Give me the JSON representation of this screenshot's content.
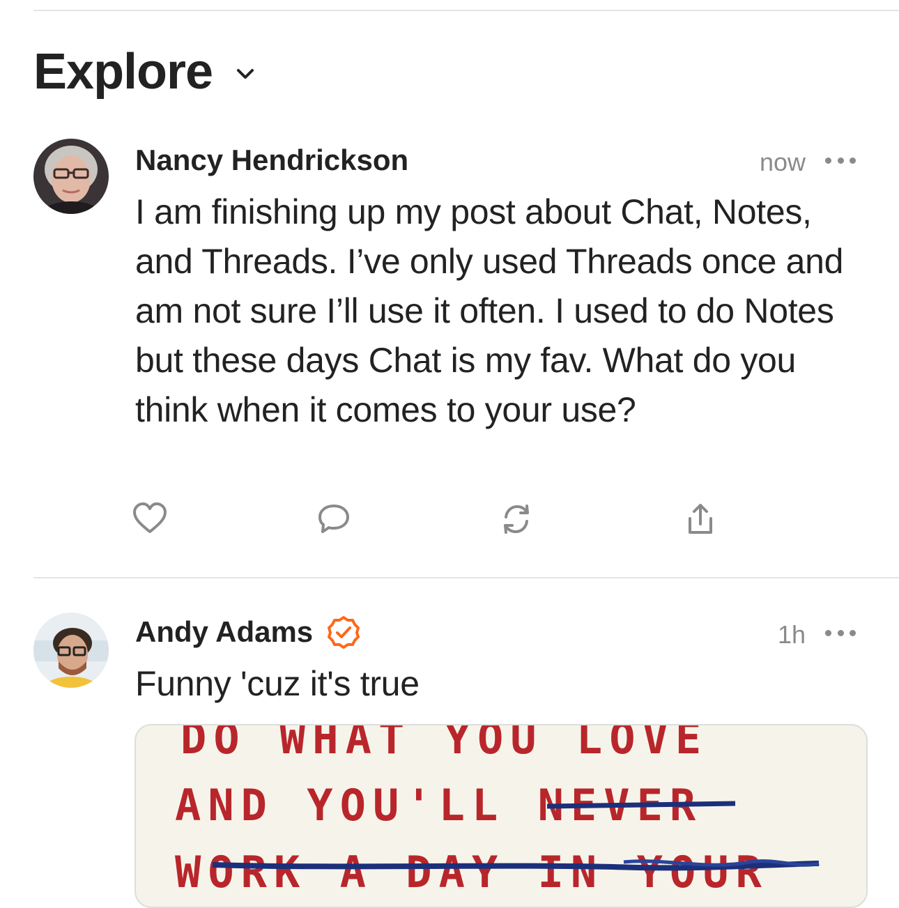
{
  "feed": {
    "title": "Explore"
  },
  "posts": [
    {
      "author": "Nancy Hendrickson",
      "time": "now",
      "text": "I am finishing up my post about Chat, Notes, and Threads. I’ve only used Threads once and am not sure I’ll use it often. I used to do Notes but these days Chat is my fav. What do you think when it comes to your use?",
      "icons": [
        "heart-icon",
        "comment-icon",
        "restack-icon",
        "share-icon"
      ]
    },
    {
      "author": "Andy Adams",
      "verified": true,
      "time": "1h",
      "text": "Funny 'cuz it's true",
      "image_text": [
        "DO WHAT YOU LOVE",
        "AND YOU'LL NEVER",
        "WORK A DAY IN YOUR"
      ]
    }
  ],
  "colors": {
    "accent": "#ff6719",
    "muted": "#8a8a8a",
    "divider": "#e4e4e4",
    "ink": "#b8262b"
  }
}
